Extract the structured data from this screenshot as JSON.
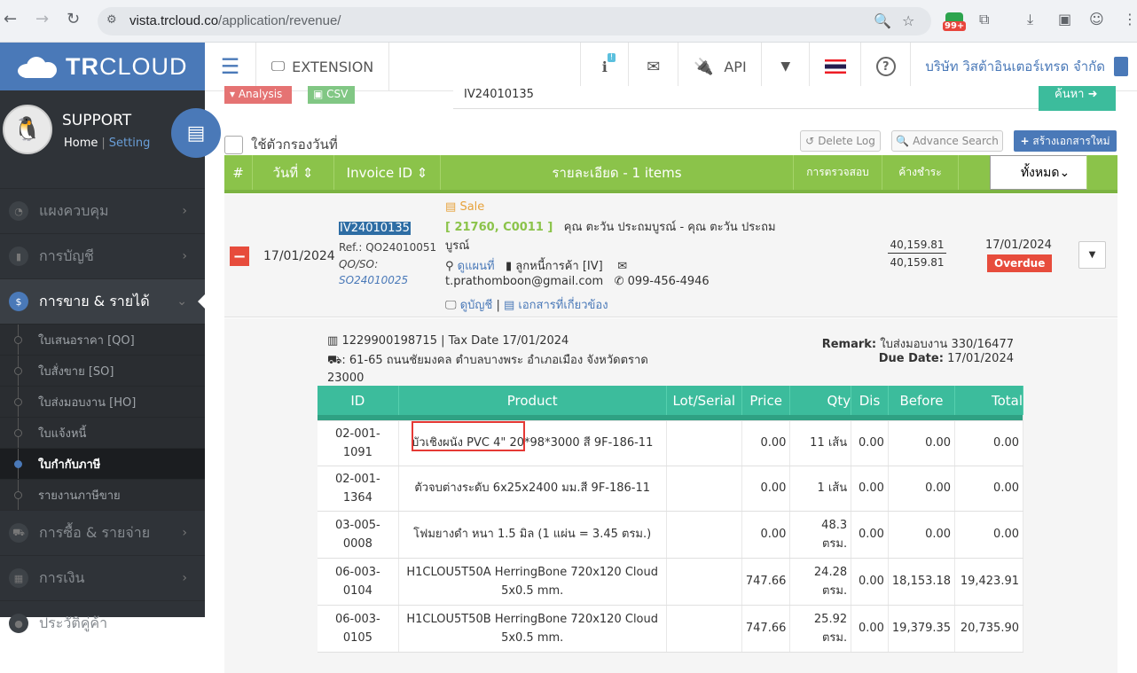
{
  "browser": {
    "url_host": "vista.trcloud.co",
    "url_path": "/application/revenue/",
    "badge": "99+"
  },
  "sidebar": {
    "logo_tr": "TR",
    "logo_cloud": "CLOUD",
    "user_name": "SUPPORT",
    "home_link": "Home",
    "setting_link": "Setting",
    "separator": "|",
    "menu": [
      {
        "label": "แผงควบคุม"
      },
      {
        "label": "การบัญชี"
      },
      {
        "label": "การขาย & รายได้"
      }
    ],
    "submenu": [
      {
        "label": "ใบเสนอราคา [QO]"
      },
      {
        "label": "ใบสั่งขาย [SO]"
      },
      {
        "label": "ใบส่งมอบงาน [HO]"
      },
      {
        "label": "ใบแจ้งหนี้"
      },
      {
        "label": "ใบกำกับภาษี"
      },
      {
        "label": "รายงานภาษีขาย"
      }
    ],
    "menu2": [
      {
        "label": "การซื้อ & รายจ่าย"
      },
      {
        "label": "การเงิน"
      },
      {
        "label": "ประวัติคู่ค้า"
      }
    ]
  },
  "topbar": {
    "extension": "EXTENSION",
    "info_badge": "!",
    "api": "API",
    "company": "บริษัท วิสต้าอินเตอร์เทรด จำกัด"
  },
  "toolbar": {
    "analysis": "Analysis",
    "csv": "CSV",
    "search_value": "IV24010135",
    "find": "ค้นหา",
    "date_filter": "ใช้ตัวกรองวันที่",
    "delete_log": "Delete Log",
    "advance_search": "Advance Search",
    "new_doc": "สร้างเอกสารใหม่"
  },
  "table_header": {
    "hash": "#",
    "date": "วันที่",
    "invoice_id": "Invoice ID",
    "details": "รายละเอียด - 1 items",
    "audit": "การตรวจสอบ",
    "outstanding": "ค้างชำระ",
    "filter": "ทั้งหมด"
  },
  "invoice": {
    "date": "17/01/2024",
    "id": "IV24010135",
    "ref": "Ref.: QO24010051",
    "qo_so": "QO/SO:",
    "so": "SO24010025",
    "type": "Sale",
    "cust_code": "[ 21760, C0011 ]",
    "cust_name": "คุณ ตะวัน ประถมบูรณ์ - คุณ ตะวัน ประถมบูรณ์",
    "map": "ดูแผนที่",
    "debtor": "ลูกหนี้การค้า [IV]",
    "email": "t.prathomboon@gmail.com",
    "phone": "099-456-4946",
    "view_account": "ดูบัญชี",
    "related_docs": "เอกสารที่เกี่ยวข้อง",
    "amount": "40,159.81",
    "balance": "40,159.81",
    "due_date": "17/01/2024",
    "status": "Overdue"
  },
  "detail": {
    "tax_line": "1229900198715 | Tax Date 17/01/2024",
    "address": "61-65 ถนนชัยมงคล ตำบลบางพระ อำเภอเมือง จังหวัดตราด 23000",
    "remark_label": "Remark:",
    "remark_value": "ใบส่งมอบงาน 330/16477",
    "due_label": "Due Date:",
    "due_value": "17/01/2024",
    "columns": [
      "ID",
      "Product",
      "Lot/Serial",
      "Price",
      "Qty",
      "Dis",
      "Before",
      "Total"
    ],
    "rows": [
      {
        "id": "02-001-1091",
        "product": "บัวเชิงผนัง PVC 4\" 20*98*3000 สี 9F-186-11",
        "lot": "",
        "price": "0.00",
        "qty": "11 เส้น",
        "dis": "0.00",
        "before": "0.00",
        "total": "0.00"
      },
      {
        "id": "02-001-1364",
        "product": "ตัวจบต่างระดับ 6x25x2400 มม.สี 9F-186-11",
        "lot": "",
        "price": "0.00",
        "qty": "1 เส้น",
        "dis": "0.00",
        "before": "0.00",
        "total": "0.00"
      },
      {
        "id": "03-005-0008",
        "product": "โฟมยางดำ หนา 1.5 มิล (1 แผ่น = 3.45 ตรม.)",
        "lot": "",
        "price": "0.00",
        "qty": "48.3 ตรม.",
        "dis": "0.00",
        "before": "0.00",
        "total": "0.00"
      },
      {
        "id": "06-003-0104",
        "product": "H1CLOU5T50A HerringBone 720x120 Cloud 5x0.5 mm.",
        "lot": "",
        "price": "747.66",
        "qty": "24.28 ตรม.",
        "dis": "0.00",
        "before": "18,153.18",
        "total": "19,423.91"
      },
      {
        "id": "06-003-0105",
        "product": "H1CLOU5T50B HerringBone 720x120 Cloud 5x0.5 mm.",
        "lot": "",
        "price": "747.66",
        "qty": "25.92 ตรม.",
        "dis": "0.00",
        "before": "19,379.35",
        "total": "20,735.90"
      }
    ]
  }
}
